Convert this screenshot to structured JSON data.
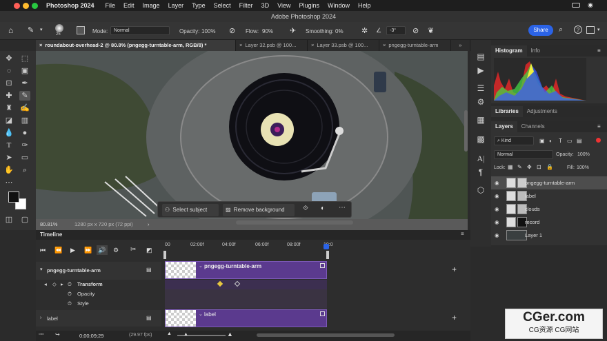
{
  "menubar": {
    "app": "Photoshop 2024",
    "items": [
      "File",
      "Edit",
      "Image",
      "Layer",
      "Type",
      "Select",
      "Filter",
      "3D",
      "View",
      "Plugins",
      "Window",
      "Help"
    ]
  },
  "titlebar": {
    "title": "Adobe Photoshop 2024"
  },
  "options": {
    "size": "25",
    "mode_label": "Mode:",
    "mode_value": "Normal",
    "opacity_label": "Opacity:",
    "opacity_value": "100%",
    "flow_label": "Flow:",
    "flow_value": "90%",
    "smoothing_label": "Smoothing:",
    "smoothing_value": "0%",
    "angle": "-3°",
    "share": "Share"
  },
  "tabs": [
    "roundabout-overhead-2 @ 80.8% (pngegg-turntable-arm, RGB/8) *",
    "Layer 32.psb @ 100...",
    "Layer 33.psb @ 100...",
    "pngegg-turntable-arm"
  ],
  "contextbar": {
    "select_subject": "Select subject",
    "remove_background": "Remove background"
  },
  "status": {
    "zoom": "80.81%",
    "doc": "1280 px x 720 px (72 ppi)"
  },
  "panels": {
    "histogram_tab": "Histogram",
    "info_tab": "Info",
    "libraries_tab": "Libraries",
    "adjustments_tab": "Adjustments",
    "layers_tab": "Layers",
    "channels_tab": "Channels",
    "kind": "Kind",
    "blend": "Normal",
    "opacity_label": "Opacity:",
    "opacity": "100%",
    "lock_label": "Lock:",
    "fill_label": "Fill:",
    "fill": "100%"
  },
  "layers": [
    {
      "name": "pngegg-turntable-arm",
      "selected": true
    },
    {
      "name": "label",
      "selected": false
    },
    {
      "name": "clouds",
      "selected": false
    },
    {
      "name": "record",
      "selected": false
    },
    {
      "name": "Layer 1",
      "selected": false
    }
  ],
  "timeline": {
    "title": "Timeline",
    "ruler": [
      "00",
      "02:00f",
      "04:00f",
      "06:00f",
      "08:00f",
      "10:0"
    ],
    "track1": "pngegg-turntable-arm",
    "transform": "Transform",
    "opacity": "Opacity",
    "style": "Style",
    "track2": "label",
    "clip1": "pngegg-turntable-arm",
    "clip2": "label",
    "timecode": "0;00;09;29",
    "fps": "(29.97 fps)"
  },
  "watermark": {
    "main": "CGer.com",
    "sub": "CG资源 CG网站"
  },
  "colors": {
    "accent": "#2b63e6",
    "clip": "#5b3a8e",
    "bg": "#2b2b2b"
  }
}
